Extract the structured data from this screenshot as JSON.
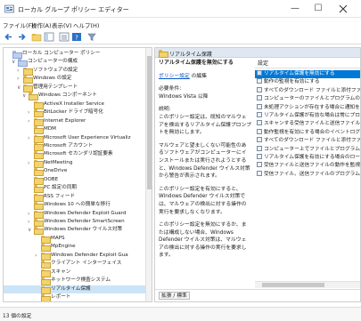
{
  "window": {
    "title": "ローカル グループ ポリシー エディター",
    "min_label": "—",
    "max_label": "☐"
  },
  "menu": [
    "ファイル(F)",
    "操作(A)",
    "表示(V)",
    "ヘルプ(H)"
  ],
  "tree": [
    {
      "label": "ローカル コンピューター ポリシー",
      "arrow": "",
      "icon": "computer",
      "level": 0
    },
    {
      "label": "コンピューターの構成",
      "arrow": "∨",
      "icon": "computer",
      "level": 1
    },
    {
      "label": "ソフトウェアの設定",
      "arrow": "›",
      "icon": "folder",
      "level": 2
    },
    {
      "label": "Windows の設定",
      "arrow": "›",
      "icon": "folder",
      "level": 2
    },
    {
      "label": "管理用テンプレート",
      "arrow": "∨",
      "icon": "folder",
      "level": 2
    },
    {
      "label": "Windows コンポーネント",
      "arrow": "∨",
      "icon": "folder",
      "level": 3
    },
    {
      "label": "ActiveX Installer Service",
      "arrow": "",
      "icon": "folder",
      "level": 4
    },
    {
      "label": "BitLocker ドライブ暗号化",
      "arrow": "›",
      "icon": "folder",
      "level": 4
    },
    {
      "label": "Internet Explorer",
      "arrow": "›",
      "icon": "folder",
      "level": 4
    },
    {
      "label": "MDM",
      "arrow": "",
      "icon": "folder",
      "level": 4
    },
    {
      "label": "Microsoft User Experience Virtualiz",
      "arrow": "›",
      "icon": "folder",
      "level": 4
    },
    {
      "label": "Microsoft アカウント",
      "arrow": "",
      "icon": "folder",
      "level": 4
    },
    {
      "label": "Microsoft セカンダリ認証要素",
      "arrow": "",
      "icon": "folder",
      "level": 4
    },
    {
      "label": "NetMeeting",
      "arrow": "›",
      "icon": "folder",
      "level": 4
    },
    {
      "label": "OneDrive",
      "arrow": "",
      "icon": "folder",
      "level": 4
    },
    {
      "label": "OOBE",
      "arrow": "",
      "icon": "folder",
      "level": 4
    },
    {
      "label": "PC 設定の同期",
      "arrow": "",
      "icon": "folder",
      "level": 4
    },
    {
      "label": "RSS フィード",
      "arrow": "",
      "icon": "folder",
      "level": 4
    },
    {
      "label": "Windows 10 への簡単な移行",
      "arrow": "",
      "icon": "folder",
      "level": 4
    },
    {
      "label": "Windows Defender Exploit Guard",
      "arrow": "›",
      "icon": "folder",
      "level": 4
    },
    {
      "label": "Windows Defender SmartScreen",
      "arrow": "›",
      "icon": "folder",
      "level": 4
    },
    {
      "label": "Windows Defender ウイルス対策",
      "arrow": "∨",
      "icon": "folder",
      "level": 4
    },
    {
      "label": "MAPS",
      "arrow": "",
      "icon": "folder",
      "level": 5
    },
    {
      "label": "MpEngine",
      "arrow": "",
      "icon": "folder",
      "level": 5
    },
    {
      "label": "Windows Defender Exploit Gua",
      "arrow": "›",
      "icon": "folder",
      "level": 5
    },
    {
      "label": "クライアント インターフェイス",
      "arrow": "",
      "icon": "folder",
      "level": 5
    },
    {
      "label": "スキャン",
      "arrow": "",
      "icon": "folder",
      "level": 5
    },
    {
      "label": "ネットワーク検査システム",
      "arrow": "",
      "icon": "folder",
      "level": 5
    },
    {
      "label": "リアルタイム保護",
      "arrow": "",
      "icon": "folder",
      "level": 5
    },
    {
      "label": "レポート",
      "arrow": "",
      "icon": "folder",
      "level": 5
    }
  ],
  "right_pane": {
    "header": "リアルタイム保護",
    "policy_title": "リアルタイム保護を無効にする",
    "edit_link": "ポリシー設定",
    "edit_suffix": " の編集",
    "requirement_label": "必要条件:",
    "requirement_value": "Windows Vista 以降",
    "description_label": "説明:",
    "description": [
      "このポリシー設定は、既知のマルウェアを検出するリアルタイム保護プロンプトを無効にします。",
      "マルウェアと望ましくない可能性のあるソフトウェアがコンピューターにインストールまたは実行されようとすると、Windows Defender ウイルス対策から警告が表示されます。",
      "このポリシー設定を有効にすると、Windows Defender ウイルス対策では、マルウェアの検出に対する操作の実行を要求しなくなります。",
      "このポリシー設定を無効にするか、または構成しない場合、Windows Defender ウイルス対策は、マルウェアの検出に対する操作の実行を要求します。"
    ],
    "column_header": "設定",
    "settings": [
      "リアルタイム保護を無効にする",
      "動作の監視を有効にする",
      "すべてのダウンロード ファイルと添付ファイル",
      "コンピューターのファイルとプログラムの動作",
      "未処理アクションが存在する場合に通知を",
      "リアルタイム保護が有効な場合は常にプロ",
      "スキャンする受信ファイルと送信ファイル",
      "動作監視を有効にする場合のイベントログ",
      "すべてのダウンロード ファイルと添付ファイル",
      "コンピューター上でファイルとプログラムの動作",
      "リアルタイム保護を有効にする場合のロー",
      "受信ファイルと送信ファイルの動作を監視",
      "受信ファイル、送信ファイルのプログラムの"
    ],
    "selected_index": 0,
    "tabs": "拡張 / 標準"
  },
  "status": "13 個の設定",
  "colors": {
    "selection": "#0078d7",
    "folder": "#f4d26c",
    "link": "#0b57c4"
  }
}
